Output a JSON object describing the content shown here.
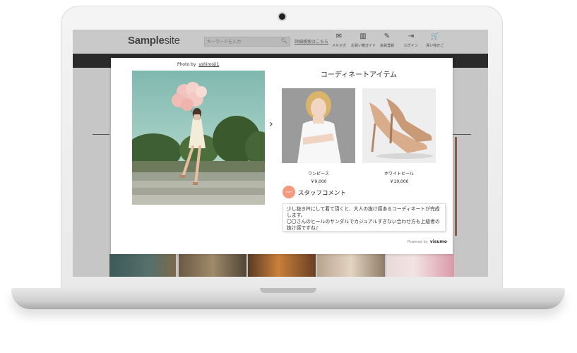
{
  "site": {
    "logo_bold": "Sample",
    "logo_light": "site",
    "search_placeholder": "キーワードを入力",
    "advanced_search": "詳細検索はこちら",
    "nav": [
      {
        "icon": "mail-icon",
        "glyph": "✉",
        "label": "メルマガ"
      },
      {
        "icon": "book-icon",
        "glyph": "▥",
        "label": "お買い物ガイド"
      },
      {
        "icon": "edit-icon",
        "glyph": "✎",
        "label": "会員登録"
      },
      {
        "icon": "login-icon",
        "glyph": "⇥",
        "label": "ログイン"
      },
      {
        "icon": "cart-icon",
        "glyph": "🛒",
        "label": "買い物かご"
      }
    ]
  },
  "modal": {
    "photo_by": "Photo by",
    "photo_user": "yshimoji1",
    "coordinate_title": "コーディネートアイテム",
    "items": [
      {
        "name": "ワンピース",
        "price": "￥9,000"
      },
      {
        "name": "ホワイトヒール",
        "price": "￥10,000"
      }
    ],
    "staff_avatar_text": "STAFF",
    "staff_title": "スタッフコメント",
    "comment": "少し抜き衿にして着て頂くと、大人の抜け感あるコーディネートが完成します。\n〇〇さんのヒールのサンダルでカジュアルすぎない合わせ方も上級者の抜け感ですね♪",
    "powered_by": "Powered by",
    "brand": "visumo"
  },
  "colors": {
    "screen_bg": "#c6c6c6",
    "dark_bar": "#2a2a2a",
    "avatar": "#f29a80"
  }
}
